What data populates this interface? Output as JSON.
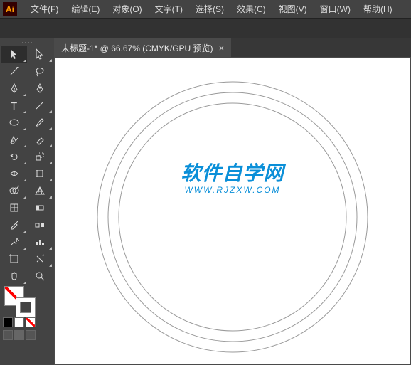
{
  "logo": "Ai",
  "menu": [
    "文件(F)",
    "编辑(E)",
    "对象(O)",
    "文字(T)",
    "选择(S)",
    "效果(C)",
    "视图(V)",
    "窗口(W)",
    "帮助(H)"
  ],
  "tab": {
    "title": "未标题-1* @ 66.67% (CMYK/GPU 预览)",
    "close": "×"
  },
  "watermark": {
    "cn": "软件自学网",
    "en": "WWW.RJZXW.COM"
  },
  "tool_names": [
    "selection",
    "direct-selection",
    "magic-wand",
    "lasso",
    "pen",
    "curvature",
    "type",
    "line",
    "rectangle",
    "paintbrush",
    "shaper",
    "eraser",
    "rotate",
    "scale",
    "width",
    "free-transform",
    "shape-builder",
    "perspective",
    "mesh",
    "gradient",
    "eyedropper",
    "blend",
    "symbol-sprayer",
    "column-graph",
    "artboard",
    "slice",
    "hand",
    "zoom"
  ],
  "chart_data": {
    "type": "diagram",
    "shapes": [
      {
        "shape": "circle",
        "r": 190,
        "stroke": "#999",
        "fill": "none"
      },
      {
        "shape": "circle",
        "r": 175,
        "stroke": "#999",
        "fill": "none"
      },
      {
        "shape": "circle",
        "r": 160,
        "stroke": "#999",
        "fill": "none"
      }
    ],
    "note": "Three concentric unfilled circles on white artboard"
  }
}
